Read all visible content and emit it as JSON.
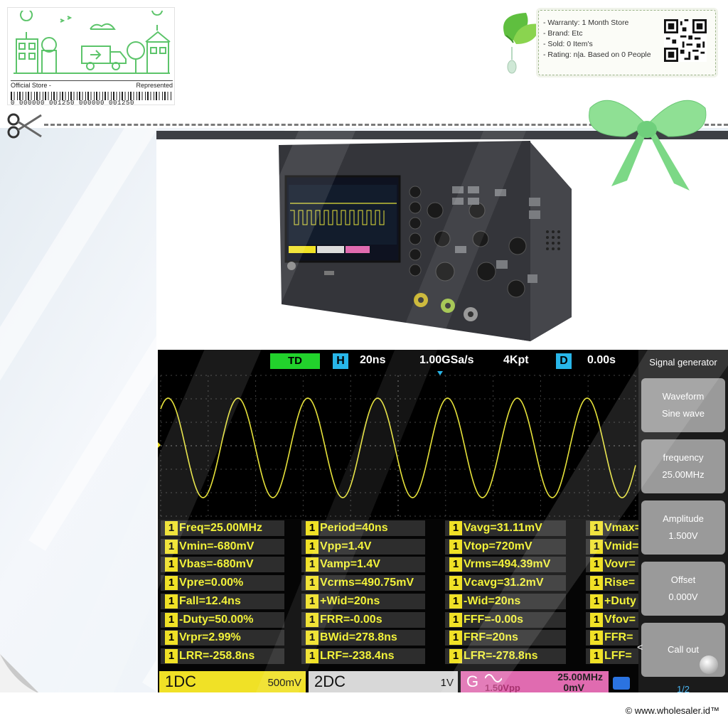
{
  "store": {
    "left_label": "Official Store -",
    "right_label": "Represented",
    "barcode_text": "0 000000 001250 000000 001250"
  },
  "info": {
    "lines": [
      "- Warranty: 1 Month Store",
      "- Brand: Etc",
      "- Sold: 0 Item's",
      "- Rating: n|a. Based on 0 People"
    ]
  },
  "scope_screen": {
    "mode_badge": "TD",
    "h_badge": "H",
    "timebase": "20ns",
    "sample_rate": "1.00GSa/s",
    "memory": "4Kpt",
    "d_badge": "D",
    "delay": "0.00s",
    "measurements": [
      [
        "Freq=25.00MHz",
        "Period=40ns",
        "Vavg=31.11mV",
        "Vmax="
      ],
      [
        "Vmin=-680mV",
        "Vpp=1.4V",
        "Vtop=720mV",
        "Vmid="
      ],
      [
        "Vbas=-680mV",
        "Vamp=1.4V",
        "Vrms=494.39mV",
        "Vovr="
      ],
      [
        "Vpre=0.00%",
        "Vcrms=490.75mV",
        "Vcavg=31.2mV",
        "Rise="
      ],
      [
        "Fall=12.4ns",
        "+Wid=20ns",
        "-Wid=20ns",
        "+Duty"
      ],
      [
        "-Duty=50.00%",
        "FRR=-0.00s",
        "FFF=-0.00s",
        "Vfov="
      ],
      [
        "Vrpr=2.99%",
        "BWid=278.8ns",
        "FRF=20ns",
        "FFR="
      ],
      [
        "LRR=-258.8ns",
        "LRF=-238.4ns",
        "LFR=-278.8ns",
        "LFF="
      ]
    ],
    "channel_number": "1",
    "ch1": {
      "label": "1DC",
      "value": "500mV"
    },
    "ch2": {
      "label": "2DC",
      "value": "1V"
    },
    "gen": {
      "label": "G",
      "freq": "25.00MHz",
      "amp": "1.50Vpp",
      "offset": "0mV"
    },
    "menu": {
      "title": "Signal generator",
      "items": [
        {
          "l1": "Waveform",
          "l2": "Sine wave"
        },
        {
          "l1": "frequency",
          "l2": "25.00MHz"
        },
        {
          "l1": "Amplitude",
          "l2": "1.500V"
        },
        {
          "l1": "Offset",
          "l2": "0.000V"
        },
        {
          "l1": "Call out",
          "l2": ""
        }
      ],
      "page": "1/2"
    }
  },
  "chart_data": {
    "type": "line",
    "title": "",
    "xlabel": "",
    "ylabel": "",
    "series": [
      {
        "waveform": "sine",
        "frequency_mhz": 25.0,
        "vpp": 1.4,
        "vmin": -0.68,
        "vmax": 0.72,
        "cycles_shown": 6.8,
        "color": "#e6e23a"
      }
    ],
    "grid": true
  },
  "footer": {
    "copyright": "© www.wholesaler.id™"
  },
  "colors": {
    "ch1": "#f0e126",
    "trigger": "#28b6e9",
    "td_badge": "#22d22c",
    "generator": "#e06bb0",
    "bow": "#7fdc88"
  }
}
